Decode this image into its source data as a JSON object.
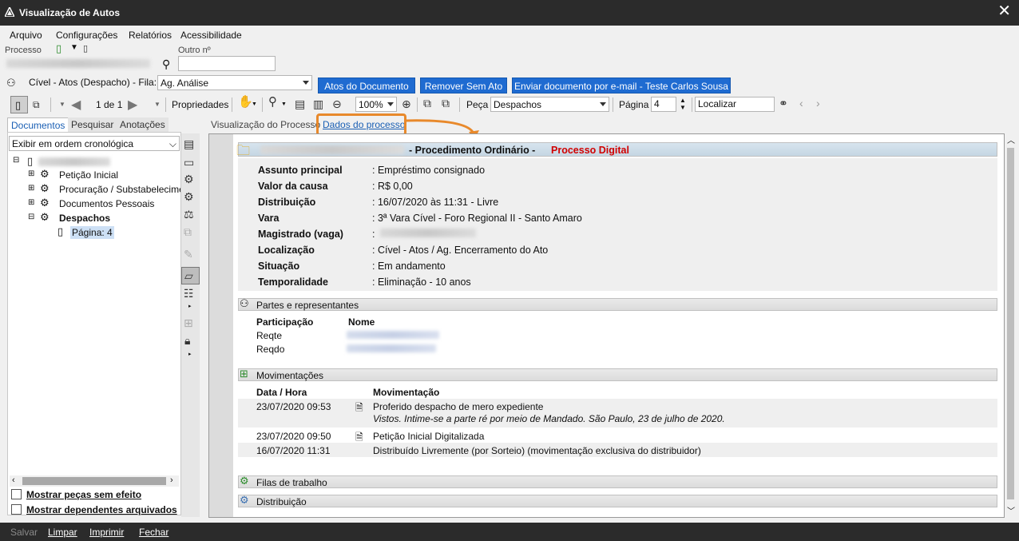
{
  "window": {
    "title": "Visualização de Autos",
    "close": "✕"
  },
  "menu": [
    "Arquivo",
    "Configurações",
    "Relatórios",
    "Acessibilidade"
  ],
  "processo": {
    "label": "Processo",
    "outro_label": "Outro nº"
  },
  "fila": {
    "label": "Cível - Atos (Despacho) - Fila:",
    "value": "Ag. Análise"
  },
  "buttons": {
    "atos": "Atos do Documento",
    "remover": "Remover Sem Ato",
    "enviar": "Enviar documento por e-mail - Teste Carlos Sousa"
  },
  "toolbar": {
    "page": "1 de 1",
    "propriedades": "Propriedades",
    "zoom": "100%",
    "peca_label": "Peça",
    "peca_value": "Despachos",
    "pagina_label": "Página",
    "pagina_value": "4",
    "localizar": "Localizar"
  },
  "left": {
    "tabs": [
      "Documentos",
      "Pesquisar",
      "Anotações"
    ],
    "order": "Exibir em ordem cronológica",
    "tree": [
      "Petição Inicial",
      "Procuração / Substabelecimen",
      "Documentos Pessoais",
      "Despachos"
    ],
    "page_node": "Página: 4",
    "check1": "Mostrar peças sem efeito",
    "check2": "Mostrar dependentes arquivados"
  },
  "content_tabs": [
    "Visualização do Processo",
    "Dados do processo"
  ],
  "header": {
    "proc": "- Procedimento Ordinário -",
    "digital": "Processo Digital"
  },
  "fields": [
    {
      "label": "Assunto principal",
      "value": ": Empréstimo consignado"
    },
    {
      "label": "Valor da causa",
      "value": ": R$ 0,00"
    },
    {
      "label": "Distribuição",
      "value": ": 16/07/2020 às 11:31 - Livre"
    },
    {
      "label": "Vara",
      "value": ": 3ª Vara Cível - Foro Regional II - Santo Amaro"
    },
    {
      "label": "Magistrado (vaga)",
      "value": ":"
    },
    {
      "label": "Localização",
      "value": ": Cível - Atos / Ag. Encerramento do Ato"
    },
    {
      "label": "Situação",
      "value": ": Em andamento"
    },
    {
      "label": "Temporalidade",
      "value": ": Eliminação - 10 anos"
    }
  ],
  "partes": {
    "title": "Partes e representantes",
    "col1": "Participação",
    "col2": "Nome",
    "rows": [
      "Reqte",
      "Reqdo"
    ]
  },
  "mov": {
    "title": "Movimentações",
    "col1": "Data / Hora",
    "col2": "Movimentação",
    "rows": [
      {
        "date": "23/07/2020 09:53",
        "text": "Proferido despacho de mero expediente",
        "sub": "Vistos. Intime-se a parte ré por meio de Mandado. São Paulo, 23 de julho de 2020."
      },
      {
        "date": "23/07/2020 09:50",
        "text": "Petição Inicial Digitalizada"
      },
      {
        "date": "16/07/2020 11:31",
        "text": "Distribuído Livremente (por Sorteio) (movimentação exclusiva do distribuidor)"
      }
    ]
  },
  "filas": "Filas de trabalho",
  "distribuicao": "Distribuição",
  "status": [
    "Salvar",
    "Limpar",
    "Imprimir",
    "Fechar"
  ],
  "colors": {
    "accent": "#1f6bd1",
    "digital": "#d00000",
    "highlight": "#e8892b",
    "titlebar": "#2b2b2b"
  }
}
